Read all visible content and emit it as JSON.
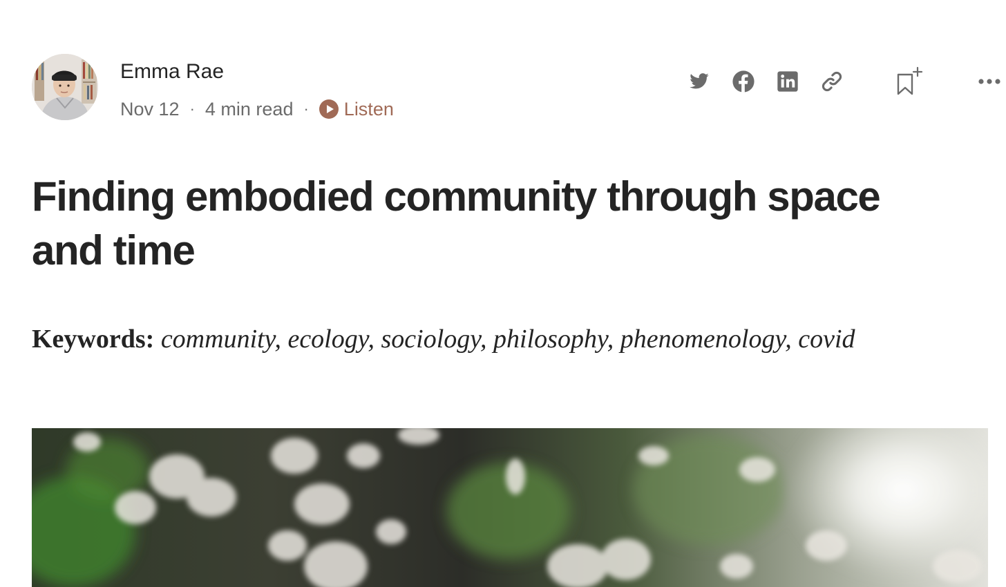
{
  "author": {
    "name": "Emma Rae",
    "date": "Nov 12",
    "read_time": "4 min read",
    "separator": "·",
    "listen_label": "Listen"
  },
  "actions": {
    "icons": [
      "twitter-icon",
      "facebook-icon",
      "linkedin-icon",
      "link-icon",
      "bookmark-add-icon",
      "more-icon"
    ]
  },
  "article": {
    "title": "Finding embodied community through space and time",
    "keywords_label": "Keywords:",
    "keywords": "community, ecology, sociology, philosophy, phenomenology, covid"
  },
  "colors": {
    "text": "#242424",
    "meta": "#6b6b6b",
    "icon": "#6b6b6b",
    "listen_accent": "#a06a56"
  }
}
